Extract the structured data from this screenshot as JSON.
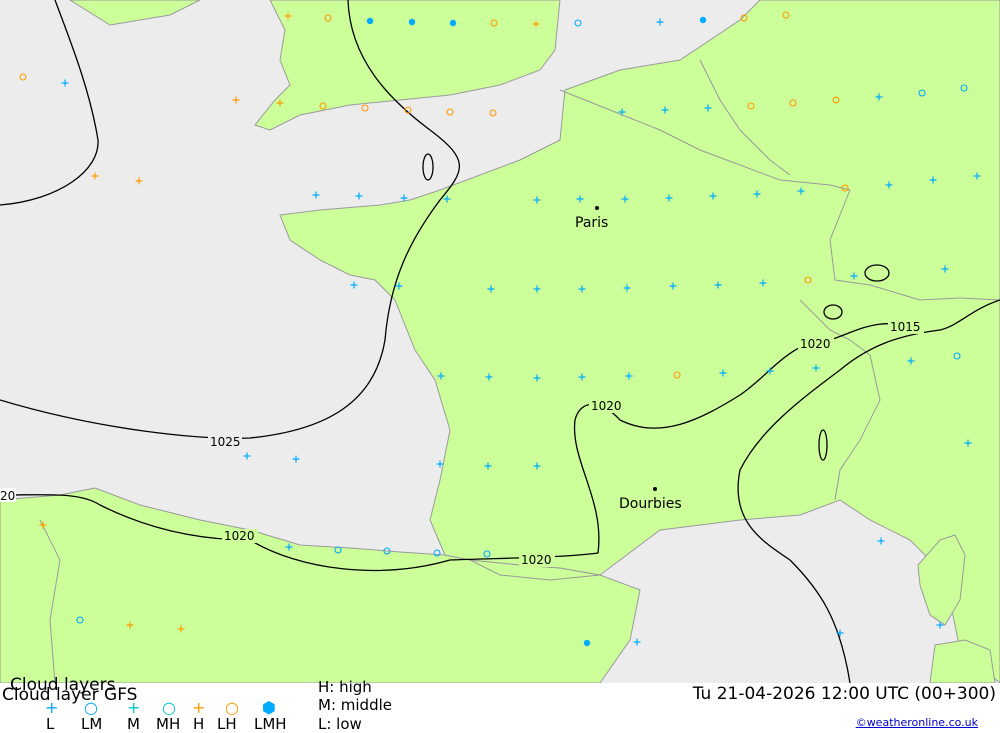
{
  "map": {
    "colors": {
      "sea": "#ececec",
      "land": "#ccff99",
      "border": "#9a9a9a",
      "isobar": "#000000",
      "high": "#00aaff",
      "mid": "#00aaff",
      "low": "#ff9900"
    },
    "cities": [
      "Paris",
      "Dourbies"
    ],
    "isobar_labels": [
      "1025",
      "20",
      "1020",
      "1020",
      "1020",
      "1020",
      "1015"
    ]
  },
  "footer": {
    "title": "Cloud layers",
    "title_overlay": "Cloud layer   GFS",
    "legend": [
      {
        "symbol": "+",
        "label": "L",
        "color": "#00aaff"
      },
      {
        "symbol": "○",
        "label": "LM",
        "color": "#00aaff"
      },
      {
        "symbol": "+",
        "label": "M",
        "color": "#00c8c8"
      },
      {
        "symbol": "○",
        "label": "MH",
        "color": "#00c8c8"
      },
      {
        "symbol": "+",
        "label": "H",
        "color": "#ff9900"
      },
      {
        "symbol": "○",
        "label": "LH",
        "color": "#ff9900"
      },
      {
        "symbol": "⬢",
        "label": "LMH",
        "color": "#00aaff"
      }
    ],
    "key_high": "H: high",
    "key_middle": "M: middle",
    "key_low": "L: low",
    "datetime": "Tu 21-04-2026 12:00 UTC (00+300)",
    "credit": "©weatheronline.co.uk"
  }
}
